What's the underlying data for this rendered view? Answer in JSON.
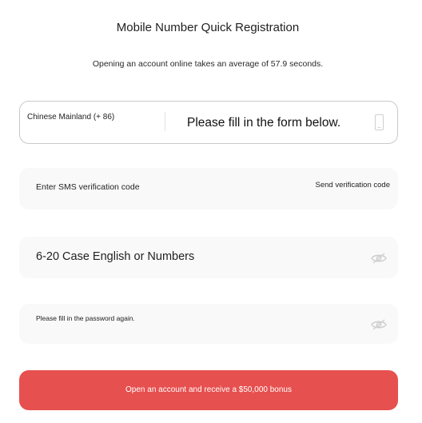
{
  "header": {
    "title": "Mobile Number Quick Registration",
    "subtitle": "Opening an account online takes an average of 57.9 seconds."
  },
  "phone": {
    "country_code": "Chinese Mainland (+ 86)",
    "placeholder": "Please fill in the form below.",
    "icon": "mobile-phone-icon"
  },
  "sms": {
    "placeholder": "Enter SMS verification code",
    "send_label": "Send verification code"
  },
  "password": {
    "placeholder": "6-20 Case English or Numbers",
    "icon": "eye-hidden-icon"
  },
  "confirm_password": {
    "placeholder": "Please fill in the password again.",
    "icon": "eye-hidden-icon"
  },
  "submit": {
    "label": "Open an account and receive a $50,000 bonus"
  },
  "colors": {
    "accent": "#e6504f",
    "field_bg": "#f9f9f9"
  }
}
